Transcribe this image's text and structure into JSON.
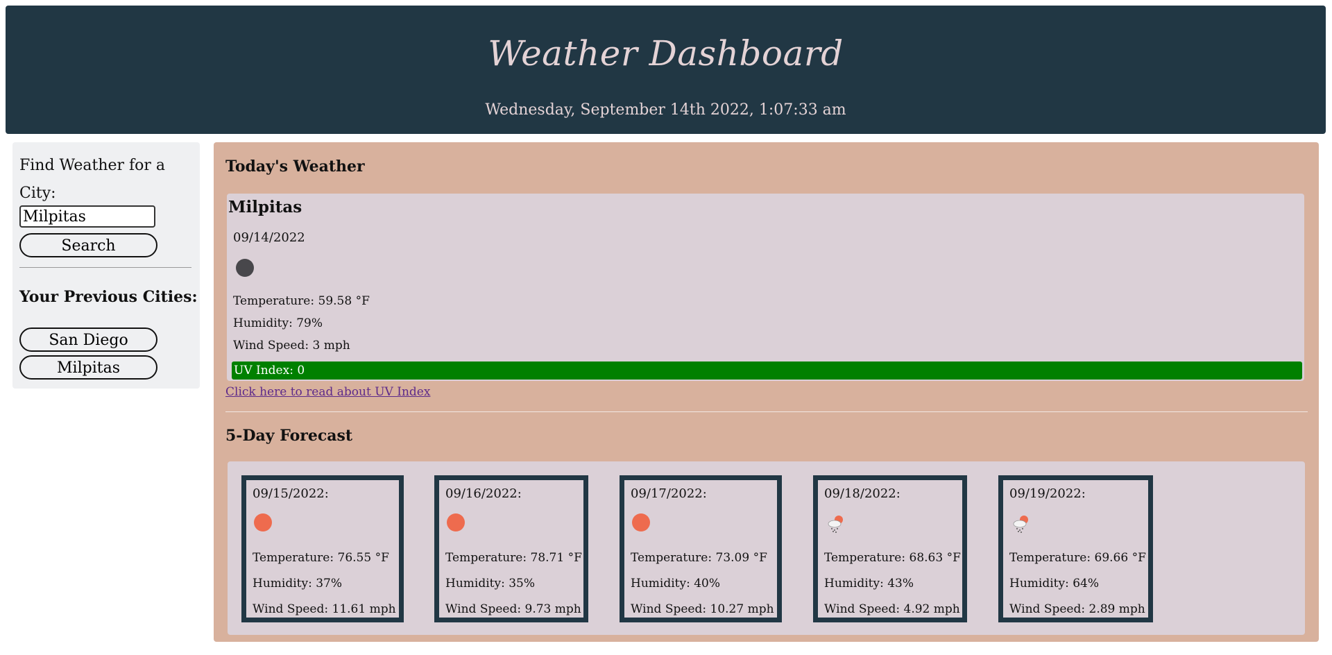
{
  "header": {
    "title": "Weather Dashboard",
    "datetime": "Wednesday, September 14th 2022, 1:07:33 am"
  },
  "sidebar": {
    "find_label": "Find Weather for a City:",
    "search_value": "Milpitas",
    "search_button": "Search",
    "previous_title": "Your Previous Cities:",
    "previous_cities": [
      "San Diego",
      "Milpitas"
    ]
  },
  "today": {
    "section_title": "Today's Weather",
    "city": "Milpitas",
    "date": "09/14/2022",
    "icon": "moon-icon",
    "temperature": "Temperature: 59.58 °F",
    "humidity": "Humidity: 79%",
    "wind": "Wind Speed: 3 mph",
    "uv": "UV Index: 0",
    "uv_color": "#008000",
    "uv_link": "Click here to read about UV Index"
  },
  "forecast": {
    "section_title": "5-Day Forecast",
    "days": [
      {
        "date": "09/15/2022:",
        "icon": "sun-icon",
        "temperature": "Temperature: 76.55 °F",
        "humidity": "Humidity: 37%",
        "wind": "Wind Speed: 11.61 mph"
      },
      {
        "date": "09/16/2022:",
        "icon": "sun-icon",
        "temperature": "Temperature: 78.71 °F",
        "humidity": "Humidity: 35%",
        "wind": "Wind Speed: 9.73 mph"
      },
      {
        "date": "09/17/2022:",
        "icon": "sun-icon",
        "temperature": "Temperature: 73.09 °F",
        "humidity": "Humidity: 40%",
        "wind": "Wind Speed: 10.27 mph"
      },
      {
        "date": "09/18/2022:",
        "icon": "sun-rain-cloud-icon",
        "temperature": "Temperature: 68.63 °F",
        "humidity": "Humidity: 43%",
        "wind": "Wind Speed: 4.92 mph"
      },
      {
        "date": "09/19/2022:",
        "icon": "sun-rain-cloud-icon",
        "temperature": "Temperature: 69.66 °F",
        "humidity": "Humidity: 64%",
        "wind": "Wind Speed: 2.89 mph"
      }
    ]
  }
}
